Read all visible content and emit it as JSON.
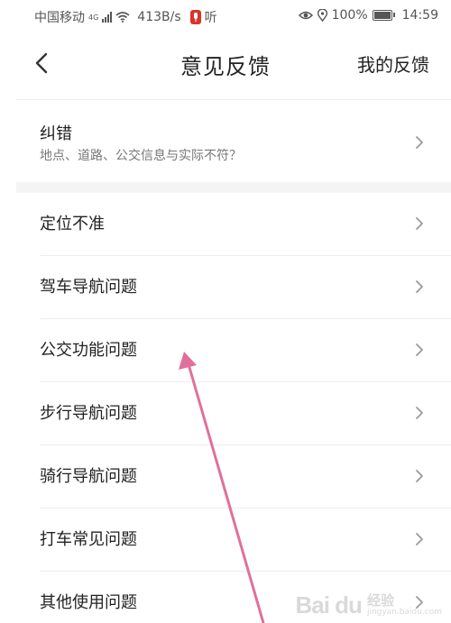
{
  "status_bar": {
    "carrier": "中国移动",
    "network_tag": "4G",
    "speed": "413B/s",
    "mic_label": "听",
    "battery_pct": "100%",
    "time": "14:59"
  },
  "header": {
    "title": "意见反馈",
    "right_link": "我的反馈"
  },
  "correction": {
    "label": "纠错",
    "subtitle": "地点、道路、公交信息与实际不符？"
  },
  "list": {
    "items": [
      {
        "label": "定位不准"
      },
      {
        "label": "驾车导航问题"
      },
      {
        "label": "公交功能问题"
      },
      {
        "label": "步行导航问题"
      },
      {
        "label": "骑行导航问题"
      },
      {
        "label": "打车常见问题"
      },
      {
        "label": "其他使用问题"
      }
    ]
  },
  "watermark": {
    "logo": "Bai du",
    "title": "经验",
    "url": "jingyan.baidu.com"
  },
  "colors": {
    "annotation_arrow": "#e0709b",
    "mic_badge": "#d9342b",
    "chevron": "#9a9a9a"
  }
}
